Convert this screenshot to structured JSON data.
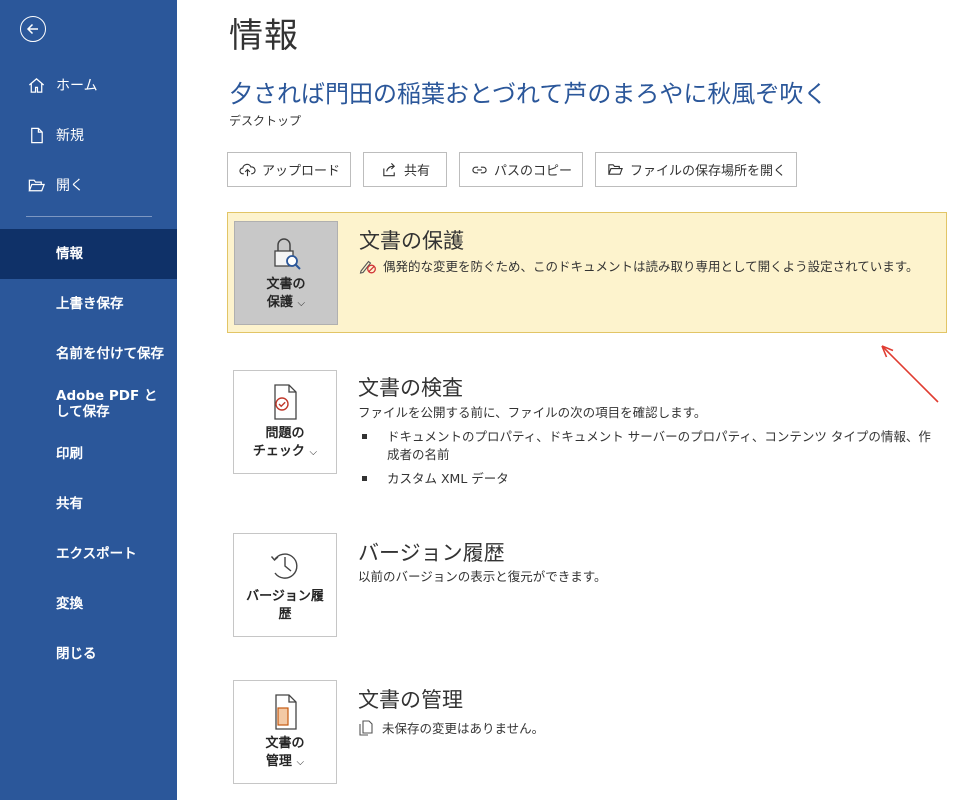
{
  "sidebar": {
    "top_items": [
      {
        "label": "ホーム",
        "icon": "home-icon"
      },
      {
        "label": "新規",
        "icon": "new-document-icon"
      },
      {
        "label": "開く",
        "icon": "open-folder-icon"
      }
    ],
    "items": [
      {
        "label": "情報",
        "active": true
      },
      {
        "label": "上書き保存"
      },
      {
        "label": "名前を付けて保存"
      },
      {
        "label": "Adobe PDF として保存"
      },
      {
        "label": "印刷"
      },
      {
        "label": "共有"
      },
      {
        "label": "エクスポート"
      },
      {
        "label": "変換"
      },
      {
        "label": "閉じる"
      }
    ]
  },
  "main": {
    "page_title": "情報",
    "document_title": "夕されば門田の稲葉おとづれて芦のまろやに秋風ぞ吹く",
    "document_location": "デスクトップ",
    "toolbar": {
      "upload": "アップロード",
      "share": "共有",
      "copy_path": "パスのコピー",
      "open_location": "ファイルの保存場所を開く"
    },
    "protect": {
      "button_line1": "文書の",
      "button_line2": "保護",
      "heading": "文書の保護",
      "description": "偶発的な変更を防ぐため、このドキュメントは読み取り専用として開くよう設定されています。"
    },
    "inspect": {
      "button_line1": "問題の",
      "button_line2": "チェック",
      "heading": "文書の検査",
      "description": "ファイルを公開する前に、ファイルの次の項目を確認します。",
      "bullets": [
        "ドキュメントのプロパティ、ドキュメント サーバーのプロパティ、コンテンツ タイプの情報、作成者の名前",
        "カスタム XML データ"
      ]
    },
    "versions": {
      "button_line1": "バージョン履",
      "button_line2": "歴",
      "heading": "バージョン履歴",
      "description": "以前のバージョンの表示と復元ができます。"
    },
    "manage": {
      "button_line1": "文書の",
      "button_line2": "管理",
      "heading": "文書の管理",
      "description": "未保存の変更はありません。"
    }
  },
  "colors": {
    "sidebar": "#2b579a",
    "sidebar_active": "#0f3168",
    "highlight": "#fdf3cd",
    "arrow": "#e03c31"
  }
}
